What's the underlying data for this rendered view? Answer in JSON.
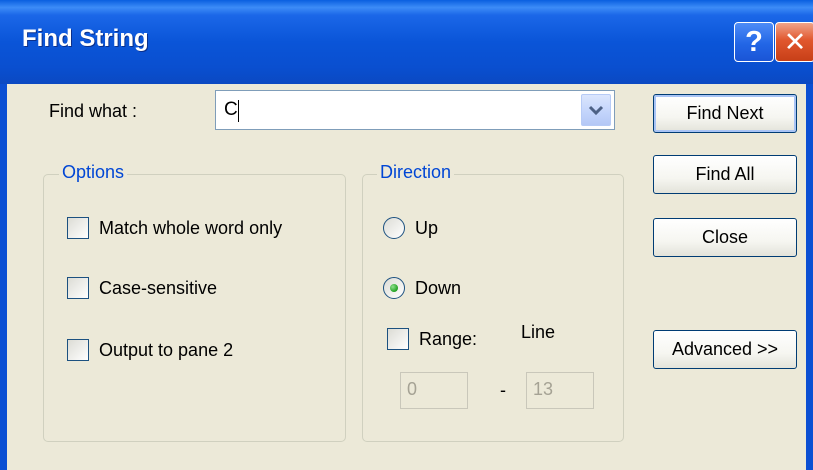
{
  "window": {
    "title": "Find String",
    "help_label": "?",
    "close_label": "✕"
  },
  "find": {
    "label": "Find what :",
    "value": "C"
  },
  "buttons": {
    "find_next": "Find Next",
    "find_all": "Find All",
    "close": "Close",
    "advanced": "Advanced >>"
  },
  "options": {
    "legend": "Options",
    "match_whole_word": {
      "label": "Match whole word only",
      "checked": false
    },
    "case_sensitive": {
      "label": "Case-sensitive",
      "checked": false
    },
    "output_pane2": {
      "label": "Output to pane 2",
      "checked": false
    }
  },
  "direction": {
    "legend": "Direction",
    "up_label": "Up",
    "down_label": "Down",
    "selected": "Down",
    "range_label": "Range:",
    "range_checked": false,
    "line_label": "Line",
    "range_from": "0",
    "range_separator": "-",
    "range_to": "13"
  },
  "colors": {
    "titlebar": "#0a55d8",
    "legend_text": "#0046d5",
    "dialog_bg": "#ece9d8"
  }
}
